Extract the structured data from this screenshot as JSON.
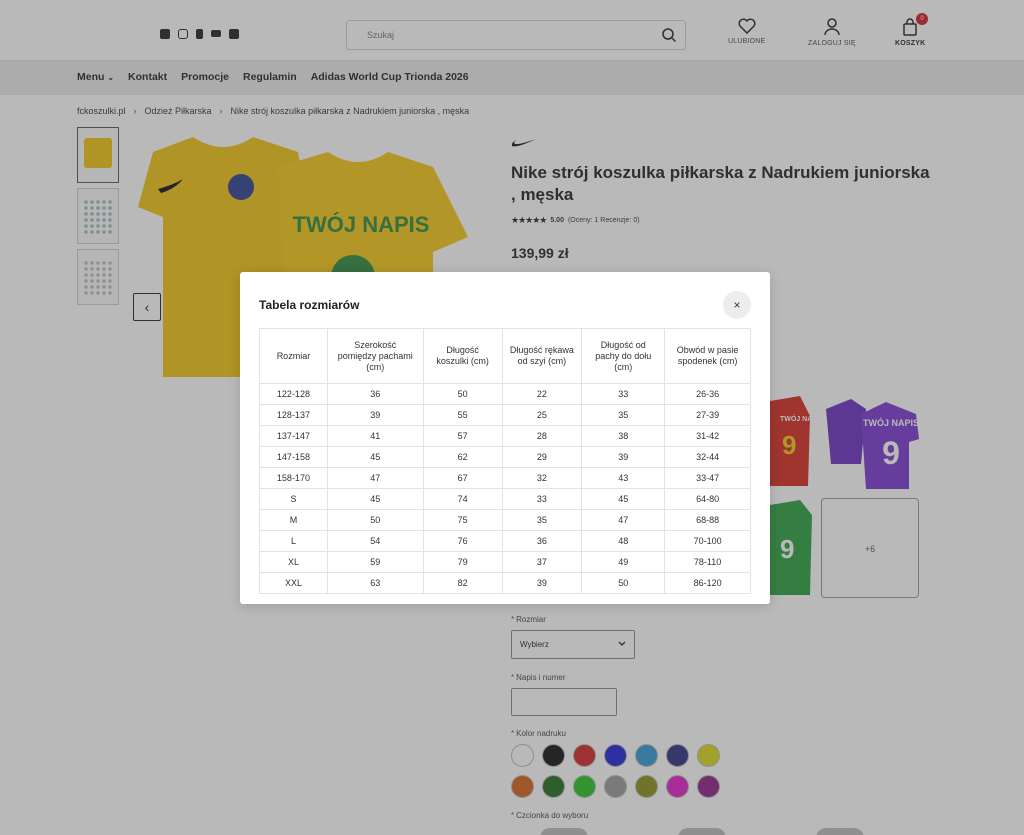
{
  "header": {
    "search_placeholder": "Szukaj",
    "favorites_label": "ULUBIONE",
    "login_label": "ZALOGUJ SIĘ",
    "cart_label": "KOSZYK",
    "cart_count": "0",
    "social_icons": [
      "facebook-icon",
      "instagram-icon",
      "tiktok-icon",
      "youtube-icon",
      "linkedin-icon"
    ]
  },
  "nav": {
    "items": [
      "Menu",
      "Kontakt",
      "Promocje",
      "Regulamin",
      "Adidas World Cup Trionda 2026"
    ]
  },
  "breadcrumb": [
    "fckoszulki.pl",
    "Odzież Piłkarska",
    "Nike strój koszulka piłkarska z Nadrukiem juniorska , męska"
  ],
  "product": {
    "title": "Nike strój koszulka piłkarska z Nadrukiem juniorska , męska",
    "rating_value": "5.00",
    "rating_meta": "(Oceny: 1 Recenzje: 0)",
    "price": "139,99 zł",
    "jersey_print": "TWÓJ NAPIS",
    "variant_print": "TWÓJ NAPIS",
    "variant_number": "9",
    "more_variants": "+6"
  },
  "form": {
    "size_label": "Rozmiar",
    "size_value": "Wybierz",
    "print_label": "Napis i numer",
    "color_label": "Kolor nadruku",
    "font_label": "Czcionka do wyboru",
    "swatches": [
      "#ffffff",
      "#111111",
      "#d42525",
      "#1e23d4",
      "#2f9bd6",
      "#2a2f7e",
      "#d8d81a",
      "#d4601a",
      "#1f6b1f",
      "#25c425",
      "#9a9a9a",
      "#8d8d1a",
      "#e020c8",
      "#8d1f86"
    ]
  },
  "modal": {
    "title": "Tabela rozmiarów",
    "close": "×",
    "headers": [
      "Rozmiar",
      "Szerokość pomiędzy pachami (cm)",
      "Długość koszulki (cm)",
      "Długość rękawa od szyi (cm)",
      "Długość od pachy do dołu (cm)",
      "Obwód w pasie spodenek (cm)"
    ],
    "rows": [
      [
        "122-128",
        "36",
        "50",
        "22",
        "33",
        "26-36"
      ],
      [
        "128-137",
        "39",
        "55",
        "25",
        "35",
        "27-39"
      ],
      [
        "137-147",
        "41",
        "57",
        "28",
        "38",
        "31-42"
      ],
      [
        "147-158",
        "45",
        "62",
        "29",
        "39",
        "32-44"
      ],
      [
        "158-170",
        "47",
        "67",
        "32",
        "43",
        "33-47"
      ],
      [
        "S",
        "45",
        "74",
        "33",
        "45",
        "64-80"
      ],
      [
        "M",
        "50",
        "75",
        "35",
        "47",
        "68-88"
      ],
      [
        "L",
        "54",
        "76",
        "36",
        "48",
        "70-100"
      ],
      [
        "XL",
        "59",
        "79",
        "37",
        "49",
        "78-110"
      ],
      [
        "XXL",
        "63",
        "82",
        "39",
        "50",
        "86-120"
      ]
    ]
  }
}
